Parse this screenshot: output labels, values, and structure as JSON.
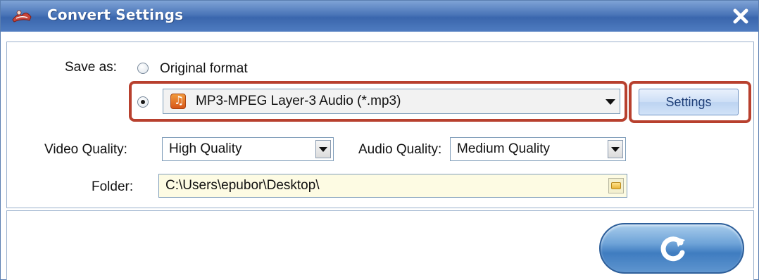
{
  "window": {
    "title": "Convert Settings"
  },
  "save_as": {
    "label": "Save as:",
    "original_format_label": "Original format",
    "original_selected": false,
    "custom_selected": true,
    "format_value": "MP3-MPEG Layer-3 Audio (*.mp3)",
    "format_icon": "music-note-icon",
    "settings_label": "Settings"
  },
  "video_quality": {
    "label": "Video Quality:",
    "value": "High Quality"
  },
  "audio_quality": {
    "label": "Audio Quality:",
    "value": "Medium Quality"
  },
  "folder": {
    "label": "Folder:",
    "value": "C:\\Users\\epubor\\Desktop\\"
  },
  "colors": {
    "highlight": "#b8402e",
    "titlebar": "#4a75b8"
  }
}
